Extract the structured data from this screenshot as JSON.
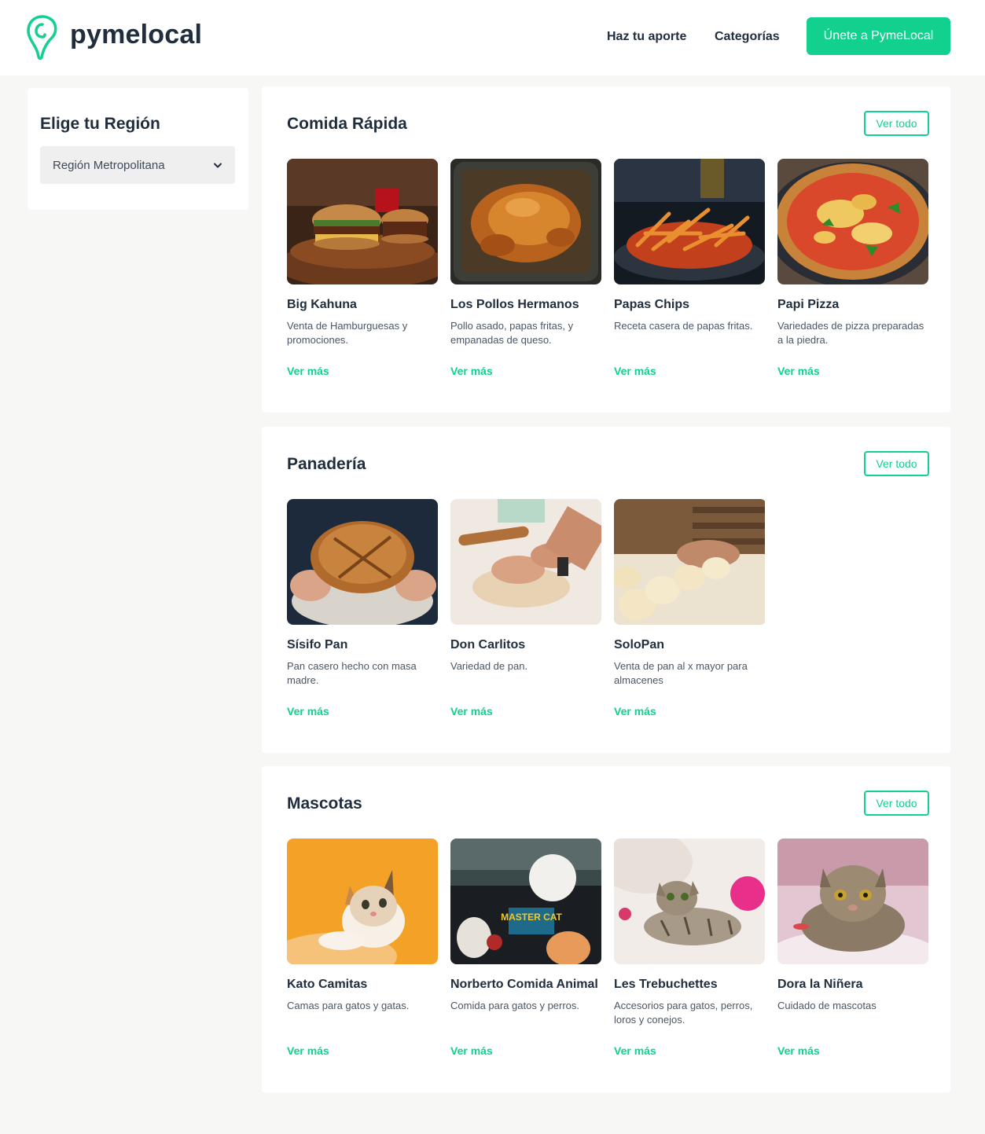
{
  "header": {
    "logo_text": "pymelocal",
    "nav": [
      "Haz tu aporte",
      "Categorías"
    ],
    "join_label": "Únete a PymeLocal",
    "accent": "#12d08e"
  },
  "region": {
    "title": "Elige tu Región",
    "selected": "Región Metropolitana"
  },
  "sections": [
    {
      "title": "Comida Rápida",
      "see_all": "Ver todo",
      "items": [
        {
          "name": "Big Kahuna",
          "desc": "Venta de Hamburguesas y promociones.",
          "more": "Ver más",
          "image": "burger-photo"
        },
        {
          "name": "Los Pollos Hermanos",
          "desc": "Pollo asado, papas fritas, y empanadas de queso.",
          "more": "Ver más",
          "image": "roast-chicken-photo"
        },
        {
          "name": "Papas Chips",
          "desc": "Receta casera de papas fritas.",
          "more": "Ver más",
          "image": "fries-photo"
        },
        {
          "name": "Papi Pizza",
          "desc": "Variedades de pizza preparadas a la piedra.",
          "more": "Ver más",
          "image": "pizza-photo"
        }
      ]
    },
    {
      "title": "Panadería",
      "see_all": "Ver todo",
      "items": [
        {
          "name": "Sísifo Pan",
          "desc": "Pan casero hecho con masa madre.",
          "more": "Ver más",
          "image": "bread-loaf-photo"
        },
        {
          "name": "Don Carlitos",
          "desc": "Variedad de pan.",
          "more": "Ver más",
          "image": "kneading-dough-photo"
        },
        {
          "name": "SoloPan",
          "desc": "Venta de pan al x mayor para almacenes",
          "more": "Ver más",
          "image": "dough-balls-photo"
        }
      ]
    },
    {
      "title": "Mascotas",
      "see_all": "Ver todo",
      "items": [
        {
          "name": "Kato Camitas",
          "desc": "Camas para gatos y gatas.",
          "more": "Ver más",
          "image": "kitten-orange-photo"
        },
        {
          "name": "Norberto Comida Animal",
          "desc": "Comida para gatos y perros.",
          "more": "Ver más",
          "image": "pet-food-photo",
          "image_text": "MASTER CAT"
        },
        {
          "name": "Les Trebuchettes",
          "desc": "Accesorios para gatos, perros, loros y conejos.",
          "more": "Ver más",
          "image": "tabby-kitten-photo"
        },
        {
          "name": "Dora la Niñera",
          "desc": "Cuidado de mascotas",
          "more": "Ver más",
          "image": "tabby-cat-photo"
        }
      ]
    }
  ]
}
